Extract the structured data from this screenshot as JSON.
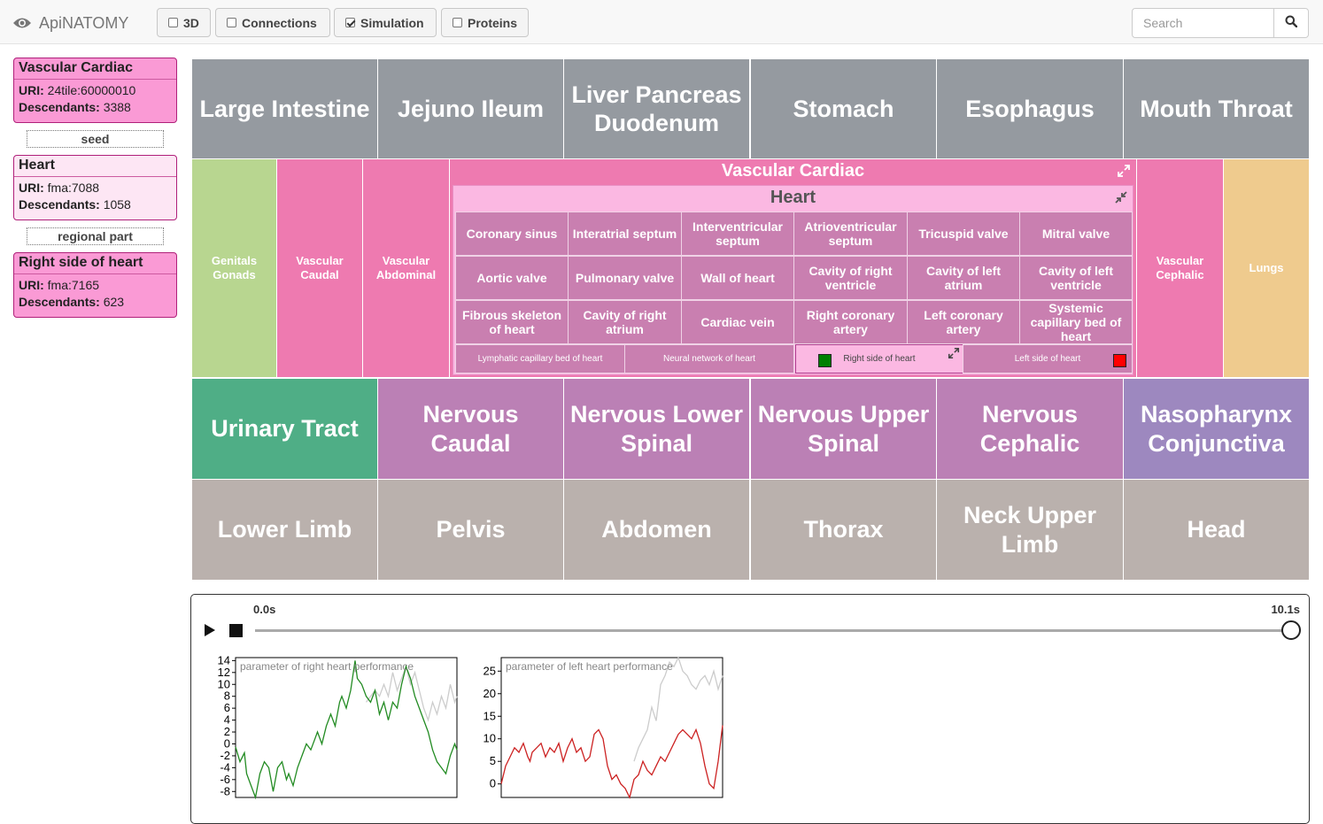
{
  "navbar": {
    "brand": "ApiNATOMY",
    "brand_icon": "eye-icon",
    "toggles": [
      {
        "label": "3D",
        "checked": false
      },
      {
        "label": "Connections",
        "checked": false
      },
      {
        "label": "Simulation",
        "checked": true
      },
      {
        "label": "Proteins",
        "checked": false
      }
    ],
    "search_placeholder": "Search",
    "search_icon": "search-icon"
  },
  "left_panel": {
    "boxes": [
      {
        "title": "Vascular Cardiac",
        "uri_label": "URI:",
        "uri": "24tile:60000010",
        "desc_label": "Descendants:",
        "descendants": "3388"
      },
      {
        "title": "Heart",
        "uri_label": "URI:",
        "uri": "fma:7088",
        "desc_label": "Descendants:",
        "descendants": "1058"
      },
      {
        "title": "Right side of heart",
        "uri_label": "URI:",
        "uri": "fma:7165",
        "desc_label": "Descendants:",
        "descendants": "623"
      }
    ],
    "relations": [
      "seed",
      "regional part"
    ]
  },
  "treemap": {
    "colors": {
      "gray": "#959aa0",
      "pink": "#ee7ab0",
      "green": "#b8d690",
      "tan": "#efcb8e",
      "teal": "#4fae86",
      "purple": "#bb80b5",
      "lavender": "#9d88bf",
      "stone": "#bab1ad",
      "heart_cell": "#c97fb0",
      "heart_bg": "#fbb8e2"
    },
    "row1": [
      "Large Intestine",
      "Jejuno Ileum",
      "Liver Pancreas Duodenum",
      "Stomach",
      "Esophagus",
      "Mouth Throat"
    ],
    "row2_left": [
      "Genitals Gonads",
      "Vascular Caudal",
      "Vascular Abdominal"
    ],
    "row2_right": [
      "Vascular Cephalic",
      "Lungs"
    ],
    "vascular_cardiac": {
      "title": "Vascular Cardiac",
      "icon": "expand-icon"
    },
    "heart": {
      "title": "Heart",
      "icon": "collapse-icon",
      "rows": [
        [
          "Coronary sinus",
          "Interatrial septum",
          "Interventricular septum",
          "Atrioventricular septum",
          "Tricuspid valve",
          "Mitral valve"
        ],
        [
          "Aortic valve",
          "Pulmonary valve",
          "Wall of heart",
          "Cavity of right ventricle",
          "Cavity of left atrium",
          "Cavity of left ventricle"
        ],
        [
          "Fibrous skeleton of heart",
          "Cavity of right atrium",
          "Cardiac vein",
          "Right coronary artery",
          "Left coronary artery",
          "Systemic capillary bed of heart"
        ]
      ],
      "bottom": [
        "Lymphatic capillary bed of heart",
        "Neural network of heart",
        "Right side of heart",
        "Left side of heart"
      ],
      "right_marker_color": "#008000",
      "left_marker_color": "#ff0000"
    },
    "row3": [
      "Urinary Tract",
      "Nervous Caudal",
      "Nervous Lower Spinal",
      "Nervous Upper Spinal",
      "Nervous Cephalic",
      "Nasopharynx Conjunctiva"
    ],
    "row4": [
      "Lower Limb",
      "Pelvis",
      "Abdomen",
      "Thorax",
      "Neck Upper Limb",
      "Head"
    ]
  },
  "simulation": {
    "time_start": "0.0s",
    "time_end": "10.1s",
    "progress": 1.0,
    "play_icon": "play-icon",
    "stop_icon": "stop-icon"
  },
  "chart_data": [
    {
      "type": "line",
      "title": "parameter of right heart performance",
      "ylim": [
        -9,
        14.5
      ],
      "yticks": [
        14,
        12,
        10,
        8,
        6,
        4,
        2,
        0,
        -2,
        -4,
        -6,
        -8
      ],
      "xlim": [
        0,
        100
      ],
      "series": [
        {
          "color": "#228b22",
          "x": [
            0,
            2,
            4,
            5,
            7,
            9,
            11,
            13,
            15,
            17,
            19,
            21,
            23,
            24,
            26,
            28,
            30,
            32,
            34,
            36,
            37,
            39,
            41,
            43,
            45,
            47,
            48,
            50,
            52,
            54,
            55,
            57,
            59,
            61,
            63,
            65,
            66,
            67,
            69,
            71,
            73,
            75,
            77,
            79,
            81,
            83,
            85,
            87,
            89,
            91,
            93,
            95,
            97,
            99,
            100
          ],
          "y": [
            -0.5,
            -3,
            -1.5,
            -5,
            -7,
            -9,
            -5,
            -3,
            -4,
            -8,
            -4,
            -3,
            -6,
            -5,
            -7,
            -4,
            -2,
            0,
            -1,
            1,
            2,
            0,
            3,
            5,
            3,
            7,
            8,
            6,
            9,
            14,
            11,
            10,
            8,
            7,
            9,
            5,
            6,
            7,
            4,
            7,
            6,
            10,
            13,
            11,
            8,
            6,
            4,
            2,
            -1,
            -3,
            -4,
            -5,
            -2,
            0,
            -1
          ]
        },
        {
          "color": "#cccccc",
          "x": [
            59,
            61,
            63,
            65,
            67,
            69,
            71,
            73,
            75,
            77,
            79,
            81,
            83,
            85,
            87,
            89,
            91,
            93,
            95,
            97,
            99,
            100
          ],
          "y": [
            7,
            8,
            9,
            8,
            10,
            8,
            12,
            9,
            11,
            13,
            10,
            12,
            9,
            6,
            4,
            7,
            5,
            8,
            6,
            10,
            7,
            8
          ]
        }
      ]
    },
    {
      "type": "line",
      "title": "parameter of left heart performance",
      "ylim": [
        -3,
        28
      ],
      "yticks": [
        25,
        20,
        15,
        10,
        5,
        0
      ],
      "xlim": [
        0,
        100
      ],
      "series": [
        {
          "color": "#cc2222",
          "x": [
            0,
            2,
            4,
            6,
            8,
            10,
            12,
            13,
            14,
            16,
            18,
            20,
            22,
            24,
            26,
            28,
            30,
            32,
            34,
            36,
            38,
            40,
            42,
            44,
            46,
            48,
            50,
            52,
            54,
            56,
            58,
            60,
            62,
            64,
            66,
            68,
            70,
            72,
            74,
            76,
            78,
            80,
            82,
            84,
            86,
            88,
            90,
            92,
            94,
            96,
            98,
            100
          ],
          "y": [
            0,
            4,
            6,
            8,
            7,
            9,
            6,
            5,
            7,
            8,
            9,
            6,
            8,
            7,
            9,
            5,
            8,
            10,
            7,
            8,
            5,
            6,
            11,
            12,
            10,
            4,
            1,
            2,
            0,
            -1,
            -3,
            1,
            2,
            5,
            3,
            2,
            4,
            6,
            5,
            7,
            9,
            11,
            12,
            11,
            10,
            12,
            9,
            4,
            0,
            -1,
            5,
            13
          ],
          "y2": [
            0,
            4,
            6,
            8,
            7,
            9,
            6,
            5,
            7,
            8,
            9,
            6,
            8,
            7,
            9,
            5,
            8,
            10,
            7,
            8,
            5,
            6,
            11,
            12,
            10,
            4,
            1,
            2,
            0,
            -1,
            -3,
            1,
            2,
            5,
            3,
            2,
            4,
            6,
            5,
            7,
            9,
            11,
            12,
            11,
            10,
            12,
            9,
            4,
            0,
            -1,
            5,
            13
          ]
        },
        {
          "color": "#cccccc",
          "x": [
            60,
            62,
            64,
            66,
            68,
            70,
            72,
            74,
            76,
            78,
            80,
            82,
            84,
            86,
            88,
            90,
            92,
            94,
            96,
            98,
            100
          ],
          "y": [
            5,
            8,
            10,
            12,
            17,
            14,
            22,
            24,
            27,
            26,
            28,
            25,
            24,
            22,
            21,
            23,
            24,
            22,
            25,
            21,
            24
          ]
        }
      ]
    }
  ]
}
